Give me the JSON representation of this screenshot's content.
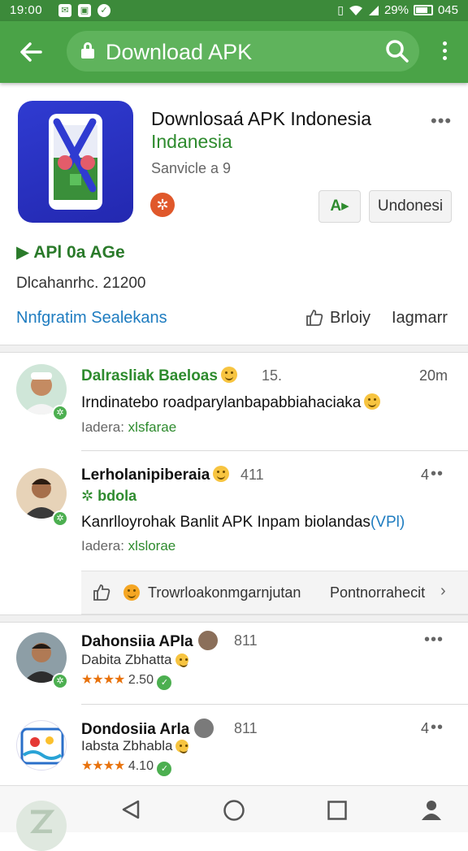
{
  "status_bar": {
    "time": "19:00",
    "battery_text": "29%",
    "clock_right": "045",
    "icons": [
      "notification-icon",
      "photo-icon",
      "check-icon",
      "vibrate-icon",
      "wifi-icon",
      "signal-icon",
      "battery-icon"
    ]
  },
  "toolbar": {
    "title": "Download APK",
    "back_icon": "arrow-left-icon",
    "search_icon": "search-icon",
    "overflow_icon": "overflow-menu-icon"
  },
  "app": {
    "name": "Downlosaá APK Indonesia",
    "subtitle": "Indanesia",
    "meta": "Sanvicle a 9",
    "button_primary": "A▸",
    "button_secondary": "Undonesi",
    "api_line": "APl 0a AGe",
    "downloads": "Dlcahanrhc. 21200",
    "info_link": "Nnfgratim Sealekans",
    "action_like": "Brloiy",
    "action_share": "Iagmarr"
  },
  "comments": [
    {
      "user": "Dalrasliak Baeloas",
      "count": "15.",
      "time": "20m",
      "text": "Irndinatebo roadparylanbapabbiahaciaka",
      "sub_label": "Iadera:",
      "sub_value": "xlsfarae"
    },
    {
      "user": "Lerholanipiberaia",
      "count": "411",
      "time": "4",
      "tag": "✲ bdola",
      "text": "Kanrlloyrohak Banlit APK Inpam biolandas",
      "text_link": "(VPl)",
      "sub_label": "Iadera:",
      "sub_value": "xlslorae"
    }
  ],
  "reply_bar": {
    "label": "Trowrloakonmgarnjutan",
    "more": "Pontnorrahecit"
  },
  "related": [
    {
      "name": "Dahonsiia APla",
      "count": "811",
      "sub": "Dabita Zbhatta",
      "stars": "★★★★",
      "rating": "2.50"
    },
    {
      "name": "Dondosiia Arla",
      "count": "811",
      "time": "4",
      "sub": "Iabsta Zbhabla",
      "stars": "★★★★",
      "rating": "4.10"
    }
  ],
  "colors": {
    "appbar": "#4aa347",
    "accent_green": "#2e8b2e",
    "link_blue": "#1e7cc0",
    "star_orange": "#e8720c"
  }
}
